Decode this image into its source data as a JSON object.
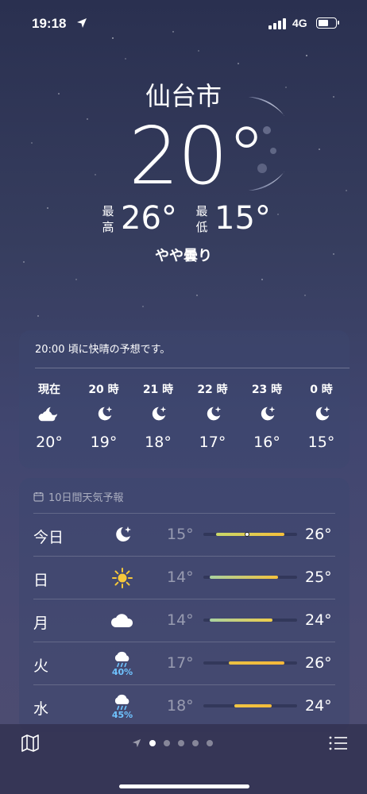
{
  "status_bar": {
    "time": "19:18",
    "network": "4G"
  },
  "location": {
    "city": "仙台市"
  },
  "current": {
    "temperature": "20°",
    "high_label": "最高",
    "high": "26°",
    "low_label": "最低",
    "low": "15°",
    "condition": "やや曇り"
  },
  "hourly": {
    "note": "20:00 頃に快晴の予想です。",
    "items": [
      {
        "label": "現在",
        "icon": "partly-cloudy-night-icon",
        "temp": "20°"
      },
      {
        "label": "20 時",
        "icon": "clear-night-icon",
        "temp": "19°"
      },
      {
        "label": "21 時",
        "icon": "clear-night-icon",
        "temp": "18°"
      },
      {
        "label": "22 時",
        "icon": "clear-night-icon",
        "temp": "17°"
      },
      {
        "label": "23 時",
        "icon": "clear-night-icon",
        "temp": "16°"
      },
      {
        "label": "0 時",
        "icon": "clear-night-icon",
        "temp": "15°"
      }
    ]
  },
  "daily": {
    "title": "10日間天気予報",
    "range": {
      "min": 13,
      "max": 28
    },
    "items": [
      {
        "day": "今日",
        "icon": "clear-night-icon",
        "precip": "",
        "low": "15°",
        "high": "26°",
        "low_value": 15,
        "high_value": 26,
        "current_value": 20,
        "bar_color": "linear-gradient(90deg,#c9d86a,#f6c03a)"
      },
      {
        "day": "日",
        "icon": "sun-icon",
        "precip": "",
        "low": "14°",
        "high": "25°",
        "low_value": 14,
        "high_value": 25,
        "bar_color": "linear-gradient(90deg,#a9d2a0,#f4c23c)"
      },
      {
        "day": "月",
        "icon": "cloud-icon",
        "precip": "",
        "low": "14°",
        "high": "24°",
        "low_value": 14,
        "high_value": 24,
        "bar_color": "linear-gradient(90deg,#a9d2a0,#efcd4a)"
      },
      {
        "day": "火",
        "icon": "rain-cloud-icon",
        "precip": "40%",
        "low": "17°",
        "high": "26°",
        "low_value": 17,
        "high_value": 26,
        "bar_color": "linear-gradient(90deg,#eac142,#f6b73a)"
      },
      {
        "day": "水",
        "icon": "rain-cloud-icon",
        "precip": "45%",
        "low": "18°",
        "high": "24°",
        "low_value": 18,
        "high_value": 24,
        "bar_color": "linear-gradient(90deg,#f1c644,#f3bb39)"
      }
    ]
  },
  "page_dots": {
    "count": 6,
    "active": 1
  }
}
